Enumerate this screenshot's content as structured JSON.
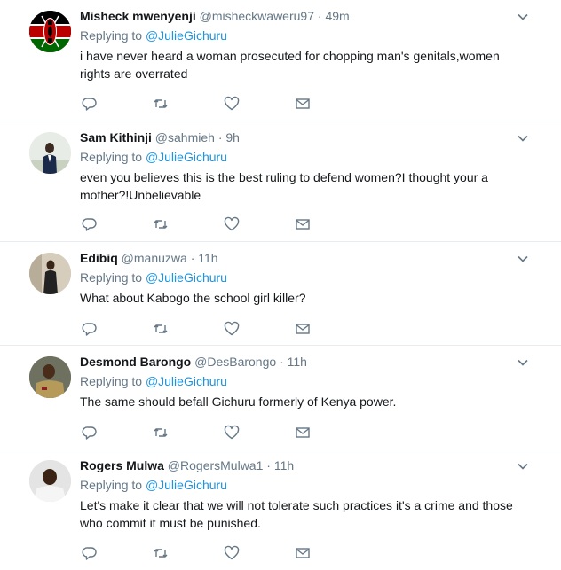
{
  "tweets": [
    {
      "name": "Misheck mwenyenji",
      "handle": "@misheckwaweru97",
      "time": "49m",
      "reply_prefix": "Replying to",
      "reply_to": "@JulieGichuru",
      "text": "i have never heard a woman prosecuted for chopping man's genitals,women rights are overrated",
      "avatar": "kenya-flag-avatar"
    },
    {
      "name": "Sam Kithinji",
      "handle": "@sahmieh",
      "time": "9h",
      "reply_prefix": "Replying to",
      "reply_to": "@JulieGichuru",
      "text": "even you believes this is the best ruling to defend women?I thought your a mother?!Unbelievable",
      "avatar": "person-photo-avatar"
    },
    {
      "name": "Edibiq",
      "handle": "@manuzwa",
      "time": "11h",
      "reply_prefix": "Replying to",
      "reply_to": "@JulieGichuru",
      "text": "What about Kabogo the school girl killer?",
      "avatar": "person-photo-avatar"
    },
    {
      "name": "Desmond Barongo",
      "handle": "@DesBarongo",
      "time": "11h",
      "reply_prefix": "Replying to",
      "reply_to": "@JulieGichuru",
      "text": "The same should befall Gichuru formerly of Kenya power.",
      "avatar": "person-photo-avatar"
    },
    {
      "name": "Rogers Mulwa",
      "handle": "@RogersMulwa1",
      "time": "11h",
      "reply_prefix": "Replying to",
      "reply_to": "@JulieGichuru",
      "text": "Let's make it clear that we will not tolerate such practices it's a crime and those who commit it must be punished.",
      "avatar": "person-photo-avatar"
    }
  ],
  "icons": {
    "reply": "reply-icon",
    "retweet": "retweet-icon",
    "like": "heart-icon",
    "dm": "envelope-icon",
    "more": "chevron-down-icon"
  },
  "colors": {
    "link": "#1b95e0",
    "secondary_text": "#657786",
    "icon": "#657786",
    "divider": "#e6ecf0"
  }
}
